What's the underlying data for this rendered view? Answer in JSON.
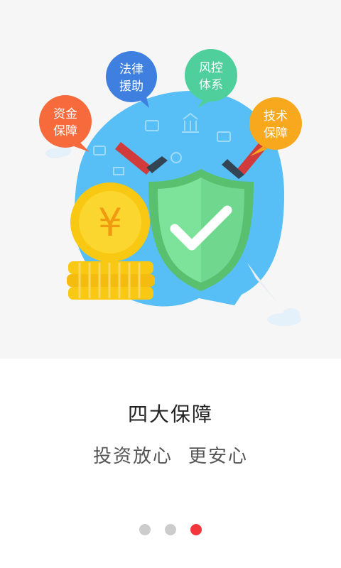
{
  "hero": {
    "bubbles": [
      {
        "label_line1": "资金",
        "label_line2": "保障",
        "color": "#f66a3b"
      },
      {
        "label_line1": "法律",
        "label_line2": "援助",
        "color": "#3f7fe0"
      },
      {
        "label_line1": "风控",
        "label_line2": "体系",
        "color": "#4fcf9b"
      },
      {
        "label_line1": "技术",
        "label_line2": "保障",
        "color": "#f8a81c"
      }
    ],
    "coin_symbol": "¥",
    "globe_color": "#57bff5",
    "shield_color": "#6fd88e"
  },
  "title": "四大保障",
  "subtitle": {
    "part1": "投资放心",
    "part2": "更安心"
  },
  "pager": {
    "total": 3,
    "active_index": 2,
    "active_color": "#f2363b"
  }
}
